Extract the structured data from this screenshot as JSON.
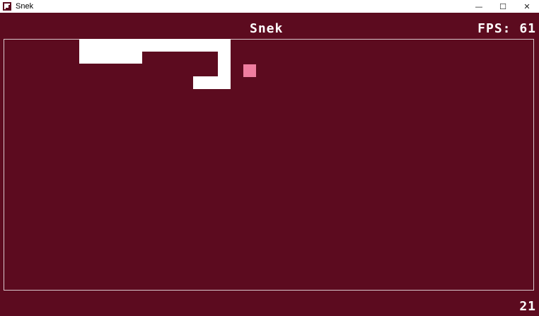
{
  "window": {
    "title": "Snek",
    "controls": {
      "minimize": "—",
      "maximize": "☐",
      "close": "✕"
    }
  },
  "hud": {
    "title": "Snek",
    "fps": "FPS: 61",
    "score": "21"
  },
  "colors": {
    "background": "#5c0b1f",
    "snake": "#ffffff",
    "food": "#f07ea0",
    "border": "#d9c7cc"
  }
}
